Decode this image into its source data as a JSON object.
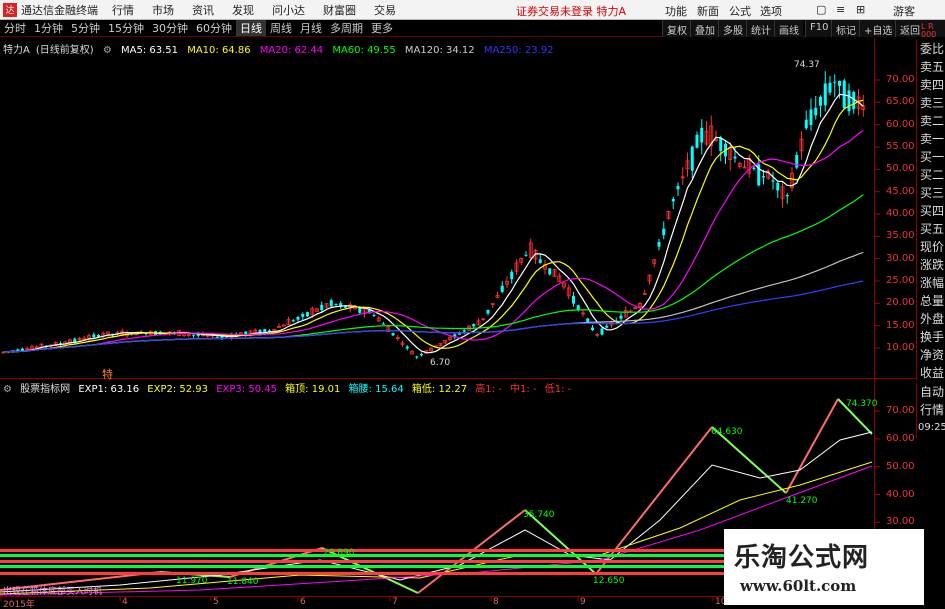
{
  "titlebar": {
    "app_name": "通达信金融终端",
    "menus": [
      "行情",
      "市场",
      "资讯",
      "发现",
      "问小达",
      "财富圈",
      "交易"
    ],
    "status": "证券交易未登录 特力A",
    "right_menus": [
      "功能",
      "新面",
      "公式",
      "选项"
    ],
    "guest": "游客",
    "min": "—",
    "max": "□",
    "close": "×"
  },
  "toolbar": {
    "periods": [
      "分时",
      "1分钟",
      "5分钟",
      "15分钟",
      "30分钟",
      "60分钟",
      "日线",
      "周线",
      "月线",
      "多周期",
      "更多"
    ],
    "active": "日线",
    "right_tools": [
      "复权",
      "叠加",
      "多股",
      "统计",
      "画线",
      "F10",
      "标记",
      "+自选",
      "返回"
    ]
  },
  "main_info": {
    "stock": "特力A",
    "mode": "(日线前复权)",
    "ma5": "MA5: 63.51",
    "ma10": "MA10: 64.86",
    "ma20": "MA20: 62.44",
    "ma60": "MA60: 49.55",
    "ma120": "MA120: 34.12",
    "ma250": "MA250: 23.92"
  },
  "sub_info": {
    "name": "股票指标网",
    "exp1": "EXP1: 63.16",
    "exp2": "EXP2: 52.93",
    "exp3": "EXP3: 50.45",
    "box_top": "箱顶: 19.01",
    "box_waist": "箱腰: 15.64",
    "box_low": "箱低: 12.27",
    "high": "高1: -",
    "mid": "中1: -",
    "low": "低1: -"
  },
  "sidebar": [
    "委比",
    "卖五",
    "卖四",
    "卖三",
    "卖二",
    "卖一",
    "买一",
    "买二",
    "买三",
    "买四",
    "买五",
    "现价",
    "涨跌",
    "涨幅",
    "总量",
    "外盘",
    "换手",
    "净资",
    "收益"
  ],
  "sidebar2": [
    "自动",
    "行情"
  ],
  "time": "09:25",
  "lr_label": {
    "l": "L",
    "r": "R",
    "num": "000"
  },
  "price_axis": [
    "70.00",
    "65.00",
    "60.00",
    "55.00",
    "50.00",
    "45.00",
    "40.00",
    "35.00",
    "30.00",
    "25.00",
    "20.00",
    "15.00",
    "10.00"
  ],
  "sub_axis": [
    "70.00",
    "60.00",
    "50.00",
    "40.00",
    "30.00",
    "20.00",
    "10.00"
  ],
  "x_axis": [
    "2015年",
    "4",
    "5",
    "6",
    "7",
    "8",
    "9",
    "10"
  ],
  "annotations": {
    "high": "74.37",
    "low": "6.70",
    "special": "特"
  },
  "sub_labels": [
    "74.370",
    "64.630",
    "41.270",
    "35.740",
    "12.650",
    "20.890",
    "11.970",
    "11.840"
  ],
  "bottom_text": "出现在箱体底部买入时机",
  "watermark": {
    "line1": "乐淘公式网",
    "line2": "www.60lt.com"
  },
  "chart_data": {
    "type": "line",
    "x": [
      "2015年",
      "4",
      "5",
      "6",
      "7",
      "8",
      "9",
      "10"
    ],
    "series": [
      {
        "name": "MA5",
        "values": [
          8,
          11,
          12,
          19,
          8,
          30,
          14,
          62,
          65
        ]
      },
      {
        "name": "MA10",
        "values": [
          8,
          10,
          12,
          18,
          9,
          29,
          15,
          58,
          65
        ]
      },
      {
        "name": "MA20",
        "values": [
          7,
          10,
          11,
          17,
          11,
          26,
          17,
          52,
          62
        ]
      },
      {
        "name": "MA60",
        "values": [
          6,
          8,
          10,
          13,
          12,
          18,
          19,
          36,
          50
        ]
      },
      {
        "name": "MA120",
        "values": [
          5,
          7,
          8,
          10,
          11,
          14,
          16,
          24,
          34
        ]
      },
      {
        "name": "MA250",
        "values": [
          4,
          5,
          6,
          7,
          8,
          10,
          12,
          17,
          24
        ]
      }
    ],
    "ylim": [
      5,
      75
    ]
  },
  "colors": {
    "up": "#ff3030",
    "down": "#00ffff",
    "ma5": "#ffffff",
    "ma10": "#ffff00",
    "ma20": "#ff00ff",
    "ma60": "#00ff00",
    "ma120": "#c0c0c0",
    "ma250": "#3040ff",
    "grid": "#800000"
  }
}
